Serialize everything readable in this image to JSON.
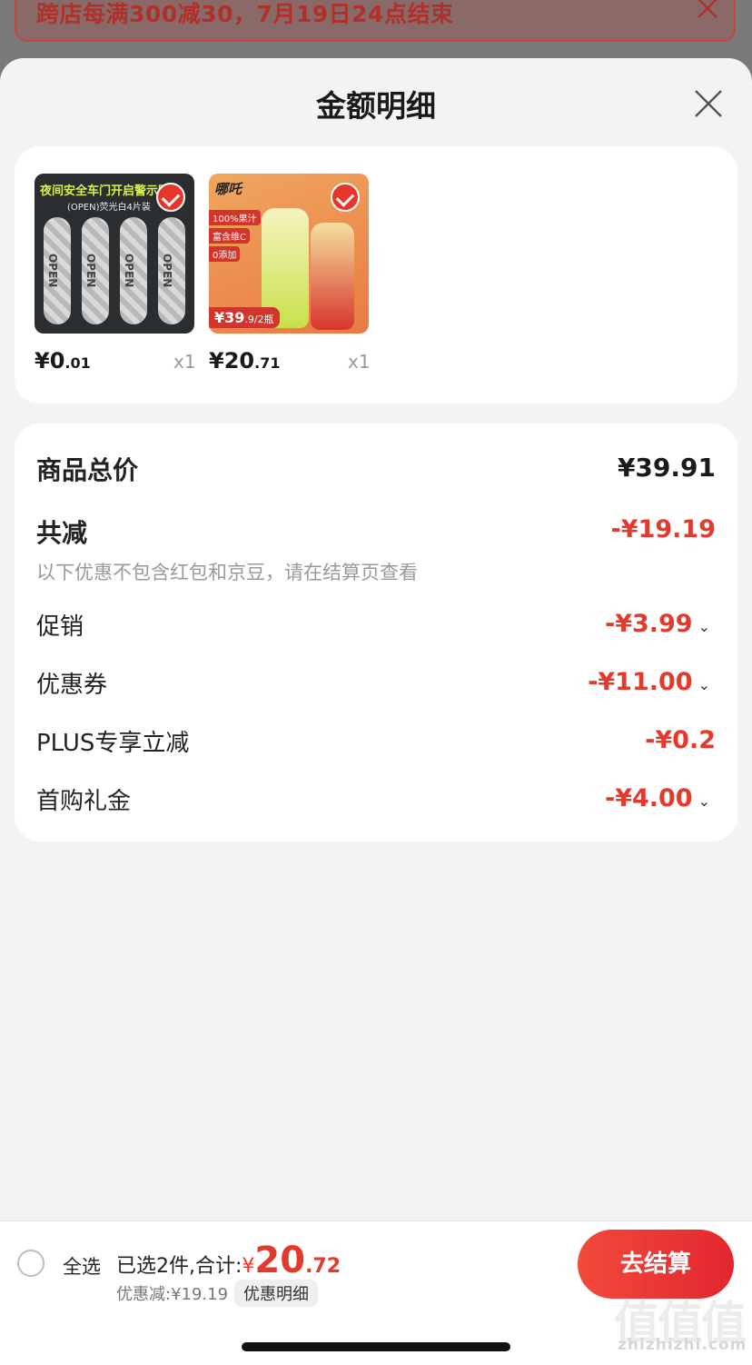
{
  "banner": {
    "text": "跨店每满300减30，7月19日24点结束"
  },
  "sheet": {
    "title": "金额明细"
  },
  "products": [
    {
      "image_title": "夜间安全车门开启警示贴",
      "image_subtitle": "(OPEN)荧光白4片装",
      "sticker_text": "OPEN",
      "price_int": "¥0",
      "price_dec": ".01",
      "qty": "x1",
      "selected": true
    },
    {
      "image_logo": "哪吒",
      "image_tags": [
        "100%果汁",
        "富含维C",
        "0添加"
      ],
      "image_price_main": "¥39",
      "image_price_sub": ".9/2瓶",
      "price_int": "¥20",
      "price_dec": ".71",
      "qty": "x1",
      "selected": true
    }
  ],
  "summary": {
    "goods_total_label": "商品总价",
    "goods_total_value": "¥39.91",
    "total_discount_label": "共减",
    "total_discount_value": "-¥19.19",
    "note": "以下优惠不包含红包和京豆，请在结算页查看",
    "items": [
      {
        "label": "促销",
        "value": "-¥3.99",
        "expandable": true
      },
      {
        "label": "优惠券",
        "value": "-¥11.00",
        "expandable": true
      },
      {
        "label": "PLUS专享立减",
        "value": "-¥0.2",
        "expandable": false
      },
      {
        "label": "首购礼金",
        "value": "-¥4.00",
        "expandable": true
      }
    ]
  },
  "bottom_bar": {
    "select_all": "全选",
    "selected_text": "已选2件,合计:",
    "currency": "¥",
    "total_int": "20",
    "total_dec": ".72",
    "discount_text": "优惠减:¥19.19",
    "detail_button": "优惠明细",
    "checkout_button": "去结算"
  },
  "watermark": {
    "big": "值值值",
    "small": "zhizhizhi.com"
  },
  "colors": {
    "accent": "#e23a2c",
    "background": "#f3f3f3"
  }
}
